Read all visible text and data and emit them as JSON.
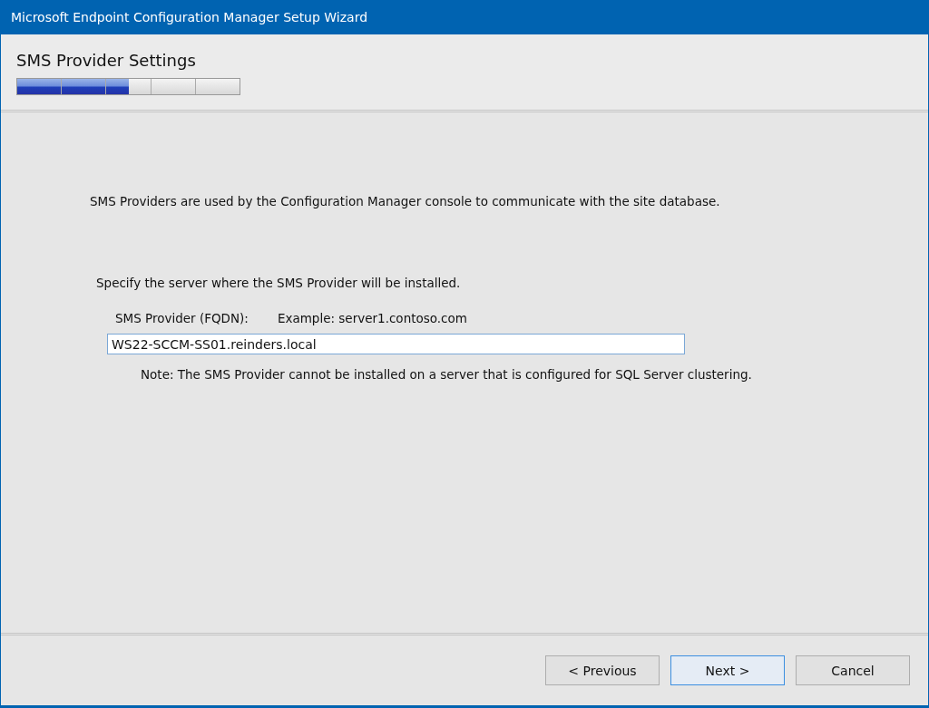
{
  "window": {
    "title": "Microsoft Endpoint Configuration Manager Setup Wizard"
  },
  "header": {
    "title": "SMS Provider Settings",
    "progress": {
      "level": 0.5
    }
  },
  "intro": "SMS Providers are used by the Configuration Manager console to communicate with the site database.",
  "instruction": "Specify the server where the SMS Provider will be installed.",
  "field": {
    "label": "SMS Provider (FQDN):",
    "example": "Example: server1.contoso.com",
    "value": "WS22-SCCM-SS01.reinders.local"
  },
  "note": "Note: The SMS Provider cannot be installed on a server that is configured for SQL Server clustering.",
  "buttons": [
    {
      "label": "< Previous",
      "default": false
    },
    {
      "label": "Next >",
      "default": true
    },
    {
      "label": "Cancel",
      "default": false
    }
  ]
}
